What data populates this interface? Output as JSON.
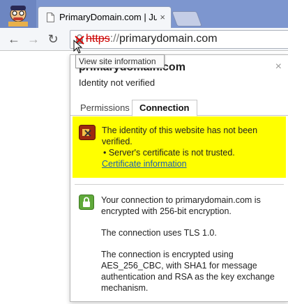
{
  "tab": {
    "title": "PrimaryDomain.com | Just",
    "close": "×"
  },
  "toolbar": {
    "back": "←",
    "forward": "→",
    "reload": "↻"
  },
  "omnibox": {
    "scheme": "https",
    "separator": "://",
    "host": "primarydomain.com"
  },
  "tooltip": "View site information",
  "bubble": {
    "domain": "primarydomain.com",
    "close": "×",
    "identity": "Identity not verified",
    "tabs": [
      "Permissions",
      "Connection"
    ],
    "warning": {
      "line1": "The identity of this website has not been verified.",
      "line2": "• Server's certificate is not trusted.",
      "link": "Certificate information"
    },
    "encryption": [
      "Your connection to primarydomain.com is encrypted with 256-bit encryption.",
      "The connection uses TLS 1.0.",
      "The connection is encrypted using AES_256_CBC, with SHA1 for message authentication and RSA as the key exchange mechanism."
    ]
  },
  "colors": {
    "warning_bg": "#ffff00",
    "link": "#1a5fb4",
    "broken_scheme": "#cc0000"
  }
}
